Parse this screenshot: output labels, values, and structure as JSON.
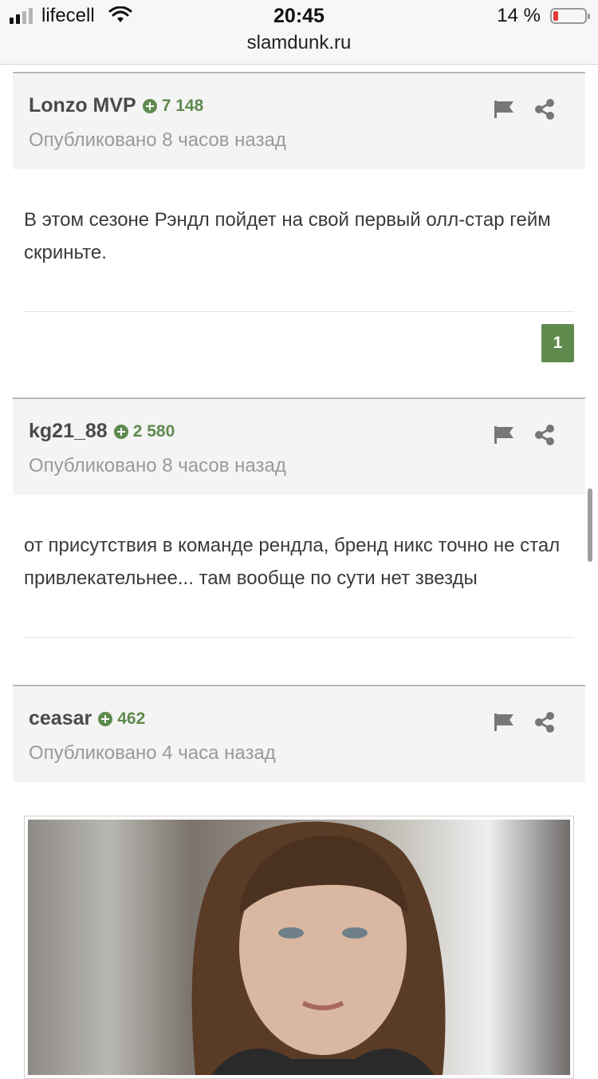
{
  "status_bar": {
    "carrier": "lifecell",
    "time": "20:45",
    "url": "slamdunk.ru",
    "battery": "14 %",
    "battery_level": 0.14
  },
  "comments": [
    {
      "author": "Lonzo MVP",
      "reputation": "7 148",
      "posted": "Опубликовано 8 часов назад",
      "text": "В этом сезоне Рэндл пойдет на свой первый олл-стар гейм скриньте.",
      "likes": "1"
    },
    {
      "author": "kg21_88",
      "reputation": "2 580",
      "posted": "Опубликовано 8 часов назад",
      "text": "от присутствия в команде рендла, бренд никс точно не стал привлекательнее... там вообще по сути нет звезды"
    },
    {
      "author": "ceasar",
      "reputation": "462",
      "posted": "Опубликовано 4 часа назад"
    }
  ],
  "colors": {
    "reputation_green": "#5f8a4e",
    "header_bg": "#f4f4f4",
    "muted_text": "#9a9a9a"
  },
  "icons": [
    "signal-icon",
    "wifi-icon",
    "battery-icon",
    "reputation-plus-icon",
    "flag-icon",
    "share-icon"
  ]
}
